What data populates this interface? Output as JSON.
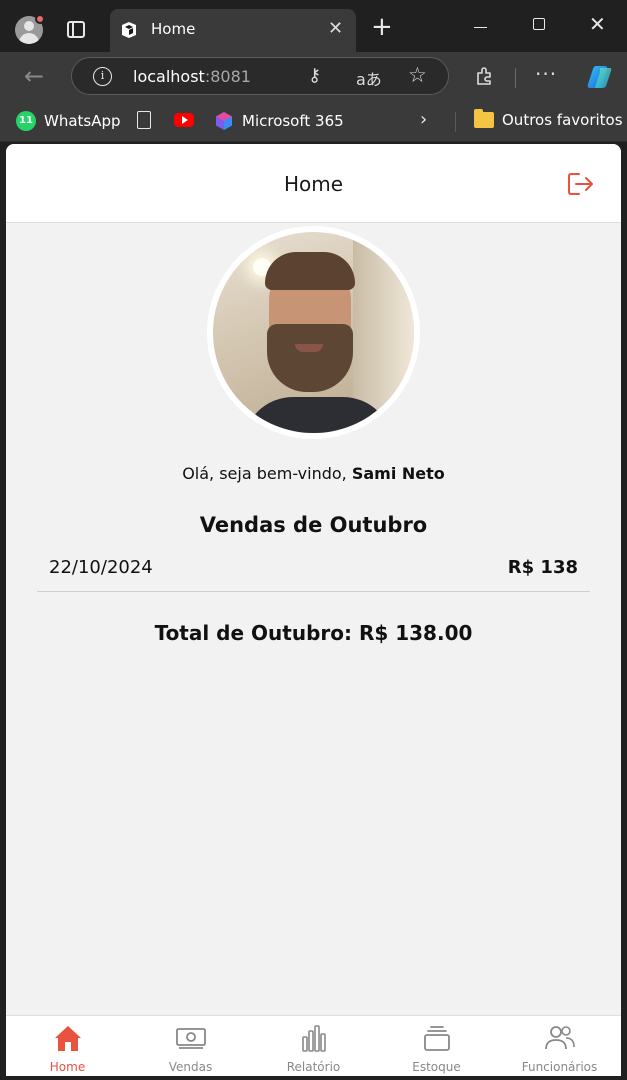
{
  "browser": {
    "tab_title": "Home",
    "url_host": "localhost",
    "url_port": ":8081",
    "bookmarks": [
      {
        "label": "WhatsApp",
        "badge": "11"
      },
      {
        "label": "Microsoft 365"
      },
      {
        "label": "Outros favoritos"
      }
    ]
  },
  "app": {
    "title": "Home",
    "greeting_prefix": "Olá, seja bem-vindo, ",
    "user_name": "Sami Neto",
    "sales_title": "Vendas de Outubro",
    "sales": [
      {
        "date": "22/10/2024",
        "value": "R$ 138"
      }
    ],
    "total": "Total de Outubro: R$ 138.00",
    "nav": [
      {
        "label": "Home",
        "icon": "home-icon",
        "active": true
      },
      {
        "label": "Vendas",
        "icon": "money-icon",
        "active": false
      },
      {
        "label": "Relatório",
        "icon": "bar-chart-icon",
        "active": false
      },
      {
        "label": "Estoque",
        "icon": "stack-icon",
        "active": false
      },
      {
        "label": "Funcionários",
        "icon": "users-icon",
        "active": false
      }
    ]
  },
  "colors": {
    "accent": "#e8523f",
    "nav_inactive": "#888888",
    "background": "#f2f2f2"
  }
}
